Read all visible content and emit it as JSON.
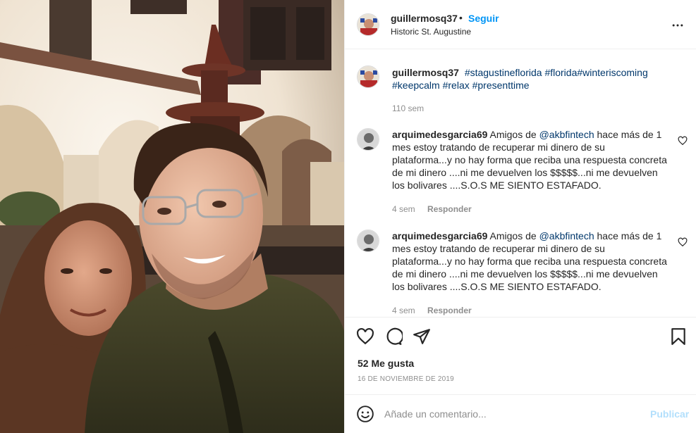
{
  "post": {
    "username": "guillermosq37",
    "separator": "•",
    "follow_label": "Seguir",
    "location": "Historic St. Augustine",
    "more_icon": "more-horizontal-icon"
  },
  "caption": {
    "username": "guillermosq37",
    "hashtags": "#stagustineflorida #florida#winteriscoming #keepcalm #relax #presenttime",
    "time": "110 sem"
  },
  "comments": [
    {
      "username": "arquimedesgarcia69",
      "text_before": "Amigos de ",
      "mention": "@akbfintech",
      "text_after": " hace más de 1 mes estoy tratando de recuperar mi dinero de su plataforma...y no hay forma que reciba una respuesta concreta de mi dinero ....ni me devuelven los $$$$$...ni me devuelven los bolivares ....S.O.S ME SIENTO ESTAFADO.",
      "time": "4 sem",
      "reply_label": "Responder"
    },
    {
      "username": "arquimedesgarcia69",
      "text_before": "Amigos de ",
      "mention": "@akbfintech",
      "text_after": " hace más de 1 mes estoy tratando de recuperar mi dinero de su plataforma...y no hay forma que reciba una respuesta concreta de mi dinero ....ni me devuelven los $$$$$...ni me devuelven los bolivares ....S.O.S ME SIENTO ESTAFADO.",
      "time": "4 sem",
      "reply_label": "Responder"
    }
  ],
  "actions": {
    "icons": [
      "heart-icon",
      "comment-icon",
      "share-icon",
      "bookmark-icon"
    ],
    "likes": "52 Me gusta",
    "date": "16 DE NOVIEMBRE DE 2019"
  },
  "add_comment": {
    "placeholder": "Añade un comentario...",
    "publish_label": "Publicar",
    "emoji_icon": "emoji-icon"
  },
  "colors": {
    "link_blue": "#0095f6",
    "hashtag_blue": "#00376b",
    "muted_gray": "#8e8e8e",
    "publish_disabled": "#b2dffc"
  }
}
